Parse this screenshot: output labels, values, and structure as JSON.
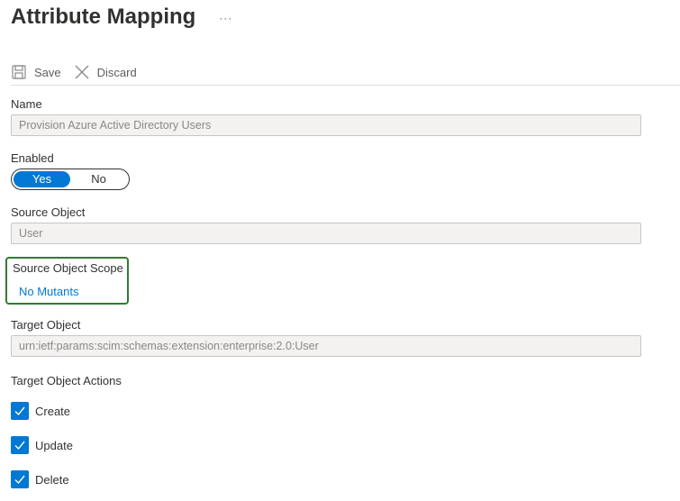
{
  "header": {
    "title": "Attribute Mapping",
    "more_label": "···"
  },
  "toolbar": {
    "save_label": "Save",
    "discard_label": "Discard"
  },
  "name_field": {
    "label": "Name",
    "value": "Provision Azure Active Directory Users"
  },
  "enabled_field": {
    "label": "Enabled",
    "options": [
      "Yes",
      "No"
    ],
    "selected": "Yes"
  },
  "source_object_field": {
    "label": "Source Object",
    "value": "User"
  },
  "source_scope": {
    "label": "Source Object Scope",
    "link_text": "No Mutants"
  },
  "target_object_field": {
    "label": "Target Object",
    "value": "urn:ietf:params:scim:schemas:extension:enterprise:2.0:User"
  },
  "target_actions": {
    "label": "Target Object Actions",
    "items": [
      {
        "label": "Create",
        "checked": true
      },
      {
        "label": "Update",
        "checked": true
      },
      {
        "label": "Delete",
        "checked": true
      }
    ]
  },
  "colors": {
    "accent": "#0078d4",
    "highlight_border": "#2e7d32",
    "disabled_fill": "#f3f2f1"
  }
}
